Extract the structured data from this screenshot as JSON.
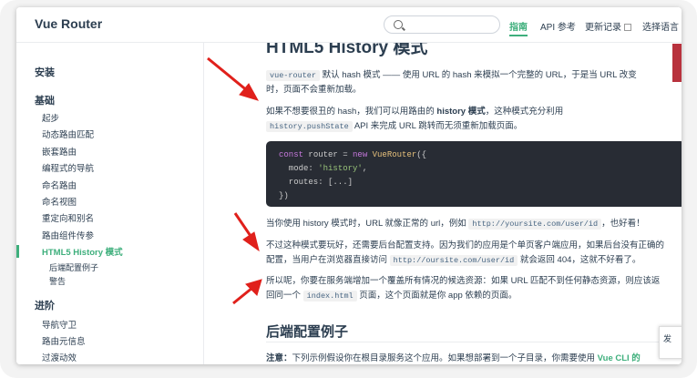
{
  "header": {
    "logo": "Vue Router",
    "nav": [
      "指南",
      "API 参考",
      "更新记录",
      "选择语言"
    ],
    "accent": "#3eaf7c"
  },
  "sidebar": {
    "groups": [
      "安装",
      "基础",
      "进阶"
    ],
    "basics": [
      "起步",
      "动态路由匹配",
      "嵌套路由",
      "编程式的导航",
      "命名路由",
      "命名视图",
      "重定向和别名",
      "路由组件传参",
      "HTML5 History 模式"
    ],
    "history_sub": [
      "后端配置例子",
      "警告"
    ],
    "advanced": [
      "导航守卫",
      "路由元信息",
      "过渡动效"
    ]
  },
  "content": {
    "title": "HTML5 History 模式",
    "p1a_code": "vue-router",
    "p1a": " 默认 hash 模式 —— 使用 URL 的 hash 来模拟一个完整的 URL，于是当 URL 改变",
    "p1b": "时，页面不会重新加载。",
    "p2a": "如果不想要很丑的 hash，我们可以用路由的 ",
    "p2a_bold": "history 模式",
    "p2a_end": "，这种模式充分利用",
    "p2b_code": "history.pushState",
    "p2b": " API 来完成 URL 跳转而无须重新加载页面。",
    "code_lines": {
      "l1_kw": "const",
      "l1_mid": " router = ",
      "l1_new": "new",
      "l1_cls": " VueRouter",
      "l1_end": "({",
      "l2": "  mode: ",
      "l2_str": "'history'",
      "l2_end": ",",
      "l3": "  routes: [...]",
      "l4": "})"
    },
    "p3a": "当你使用 history 模式时，URL 就像正常的 url，例如 ",
    "p3a_code": "http://yoursite.com/user/id",
    "p3a_end": "，也好看！",
    "p4a": "不过这种模式要玩好，还需要后台配置支持。因为我们的应用是个单页客户端应用，如果后台没有正确的",
    "p4b": "配置，当用户在浏览器直接访问 ",
    "p4b_code": "http://oursite.com/user/id",
    "p4b_end": " 就会返回 404，这就不好看了。",
    "p5a": "所以呢，你要在服务端增加一个覆盖所有情况的候选资源：如果 URL 匹配不到任何静态资源，则应该返",
    "p5b": "回同一个 ",
    "p5b_code": "index.html",
    "p5b_end": " 页面，这个页面就是你 app 依赖的页面。",
    "h2": "后端配置例子",
    "note_bold": "注意：",
    "note": "下列示例假设你在根目录服务这个应用。如果想部署到一个子目录，你需要使用 ",
    "note_link": "Vue CLI 的"
  },
  "float_button": "发",
  "annotation_color": "#e0201b"
}
